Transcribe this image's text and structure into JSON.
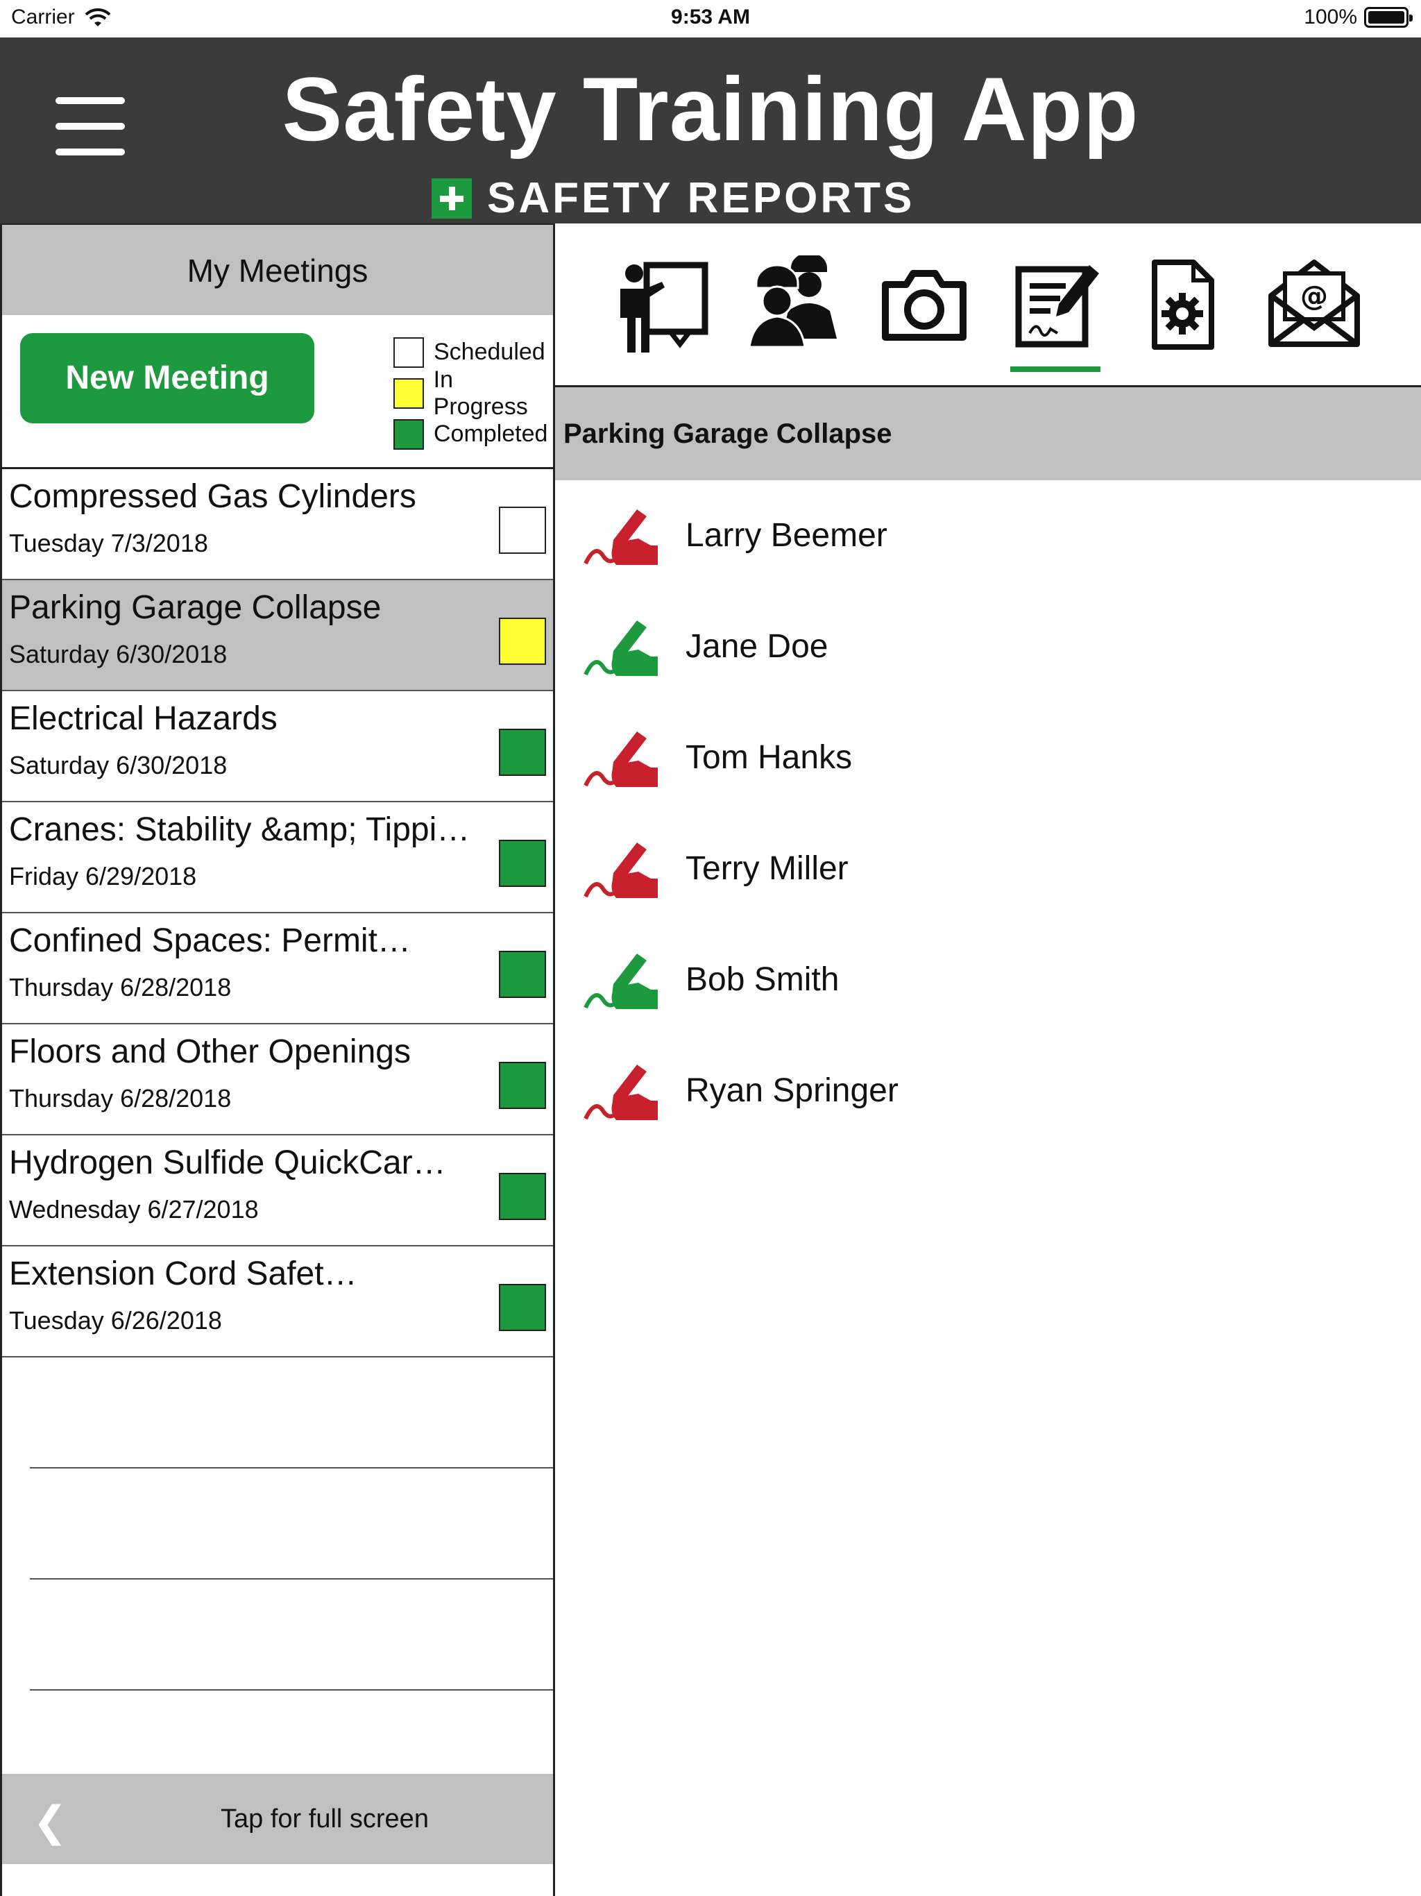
{
  "status_bar": {
    "carrier": "Carrier",
    "time": "9:53 AM",
    "battery": "100%"
  },
  "header": {
    "title": "Safety Training App",
    "brand": "SAFETY REPORTS"
  },
  "left_panel": {
    "title": "My Meetings",
    "new_meeting_label": "New Meeting",
    "legend": [
      {
        "label": "Scheduled",
        "color": "#ffffff"
      },
      {
        "label": "In Progress",
        "color": "#ffff33"
      },
      {
        "label": "Completed",
        "color": "#1e9a3e"
      }
    ],
    "meetings": [
      {
        "title": "Compressed Gas Cylinders",
        "date": "Tuesday 7/3/2018",
        "status": "Scheduled",
        "color": "#ffffff"
      },
      {
        "title": "Parking Garage Collapse",
        "date": "Saturday 6/30/2018",
        "status": "In Progress",
        "color": "#ffff33"
      },
      {
        "title": "Electrical Hazards",
        "date": "Saturday 6/30/2018",
        "status": "Completed",
        "color": "#1e9a3e"
      },
      {
        "title": "Cranes: Stability &amp; Tippi…",
        "date": "Friday 6/29/2018",
        "status": "Completed",
        "color": "#1e9a3e"
      },
      {
        "title": "Confined Spaces: Permit…",
        "date": "Thursday 6/28/2018",
        "status": "Completed",
        "color": "#1e9a3e"
      },
      {
        "title": "Floors and Other Openings",
        "date": "Thursday 6/28/2018",
        "status": "Completed",
        "color": "#1e9a3e"
      },
      {
        "title": "Hydrogen Sulfide QuickCar…",
        "date": "Wednesday 6/27/2018",
        "status": "Completed",
        "color": "#1e9a3e"
      },
      {
        "title": "Extension Cord Safet…",
        "date": "Tuesday 6/26/2018",
        "status": "Completed",
        "color": "#1e9a3e"
      }
    ],
    "fullscreen_label": "Tap for full screen"
  },
  "toolbar": {
    "icons": [
      "presenter-icon",
      "workers-icon",
      "camera-icon",
      "signature-document-icon",
      "settings-document-icon",
      "email-icon"
    ],
    "active": "signature-document-icon"
  },
  "right_panel": {
    "meeting_title": "Parking Garage Collapse",
    "attendees": [
      {
        "name": "Larry Beemer",
        "signed": false,
        "color": "#c8202c"
      },
      {
        "name": "Jane Doe",
        "signed": true,
        "color": "#1e9a3e"
      },
      {
        "name": "Tom Hanks",
        "signed": false,
        "color": "#c8202c"
      },
      {
        "name": "Terry Miller",
        "signed": false,
        "color": "#c8202c"
      },
      {
        "name": "Bob Smith",
        "signed": true,
        "color": "#1e9a3e"
      },
      {
        "name": "Ryan Springer",
        "signed": false,
        "color": "#c8202c"
      }
    ]
  }
}
